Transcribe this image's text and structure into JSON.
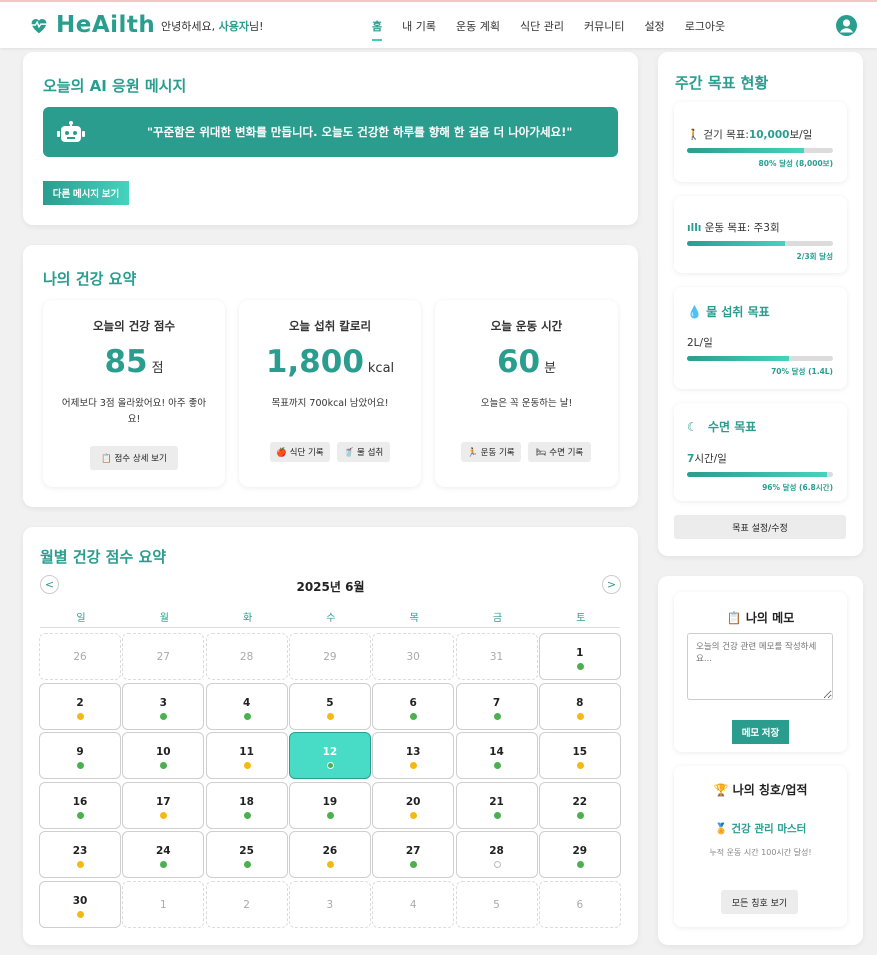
{
  "app": {
    "logo": "HeAilth",
    "greeting_prefix": "안녕하세요,",
    "user_name": "사용자",
    "greeting_suffix": "님!"
  },
  "nav": [
    "홈",
    "내 기록",
    "운동 계획",
    "식단 관리",
    "커뮤니티",
    "설정",
    "로그아웃"
  ],
  "nav_active": "홈",
  "ai": {
    "title": "오늘의 AI 응원 메시지",
    "message": "\"꾸준함은 위대한 변화를 만듭니다. 오늘도 건강한 하루를 향해 한 걸음 더 나아가세요!\"",
    "button": "다른 메시지 보기"
  },
  "summary": {
    "title": "나의 건강 요약",
    "score": {
      "title": "오늘의 건강 점수",
      "value": "85",
      "unit": "점",
      "desc": "어제보다 3점 올라왔어요! 아주 좋아요!",
      "button": "📋 점수 상세 보기"
    },
    "calories": {
      "title": "오늘 섭취 칼로리",
      "value": "1,800",
      "unit": "kcal",
      "desc": "목표까지 700kcal 남았어요!",
      "button1": "🍎 식단 기록",
      "button2": "🥤 물 섭취"
    },
    "exercise": {
      "title": "오늘 운동 시간",
      "value": "60",
      "unit": "분",
      "desc": "오늘은 꼭 운동하는 날!",
      "button1": "🏃 운동 기록",
      "button2": "🛏 수면 기록"
    }
  },
  "calendar": {
    "title": "월별 건강 점수 요약",
    "month": "2025년 6월",
    "prev": "<",
    "next": ">",
    "weekdays": [
      "일",
      "월",
      "화",
      "수",
      "목",
      "금",
      "토"
    ],
    "days": [
      {
        "n": "26",
        "t": "o"
      },
      {
        "n": "27",
        "t": "o"
      },
      {
        "n": "28",
        "t": "o"
      },
      {
        "n": "29",
        "t": "o"
      },
      {
        "n": "30",
        "t": "o"
      },
      {
        "n": "31",
        "t": "o"
      },
      {
        "n": "1",
        "t": "c",
        "d": "g"
      },
      {
        "n": "2",
        "t": "c",
        "d": "y"
      },
      {
        "n": "3",
        "t": "c",
        "d": "g"
      },
      {
        "n": "4",
        "t": "c",
        "d": "g"
      },
      {
        "n": "5",
        "t": "c",
        "d": "y"
      },
      {
        "n": "6",
        "t": "c",
        "d": "g"
      },
      {
        "n": "7",
        "t": "c",
        "d": "g"
      },
      {
        "n": "8",
        "t": "c",
        "d": "y"
      },
      {
        "n": "9",
        "t": "c",
        "d": "g"
      },
      {
        "n": "10",
        "t": "c",
        "d": "g"
      },
      {
        "n": "11",
        "t": "c",
        "d": "y"
      },
      {
        "n": "12",
        "t": "today",
        "d": "w"
      },
      {
        "n": "13",
        "t": "c",
        "d": "y"
      },
      {
        "n": "14",
        "t": "c",
        "d": "g"
      },
      {
        "n": "15",
        "t": "c",
        "d": "y"
      },
      {
        "n": "16",
        "t": "c",
        "d": "g"
      },
      {
        "n": "17",
        "t": "c",
        "d": "y"
      },
      {
        "n": "18",
        "t": "c",
        "d": "g"
      },
      {
        "n": "19",
        "t": "c",
        "d": "g"
      },
      {
        "n": "20",
        "t": "c",
        "d": "y"
      },
      {
        "n": "21",
        "t": "c",
        "d": "g"
      },
      {
        "n": "22",
        "t": "c",
        "d": "g"
      },
      {
        "n": "23",
        "t": "c",
        "d": "y"
      },
      {
        "n": "24",
        "t": "c",
        "d": "g"
      },
      {
        "n": "25",
        "t": "c",
        "d": "g"
      },
      {
        "n": "26",
        "t": "c",
        "d": "y"
      },
      {
        "n": "27",
        "t": "c",
        "d": "g"
      },
      {
        "n": "28",
        "t": "c",
        "d": "e"
      },
      {
        "n": "29",
        "t": "c",
        "d": "g"
      },
      {
        "n": "30",
        "t": "c",
        "d": "y"
      },
      {
        "n": "1",
        "t": "o"
      },
      {
        "n": "2",
        "t": "o"
      },
      {
        "n": "3",
        "t": "o"
      },
      {
        "n": "4",
        "t": "o"
      },
      {
        "n": "5",
        "t": "o"
      },
      {
        "n": "6",
        "t": "o"
      }
    ]
  },
  "goals": {
    "title": "주간 목표 현황",
    "walk": {
      "prefix": "걷기 목표:",
      "value": "10,000",
      "suffix": "보/일",
      "pct": "80% 달성 (8,000보)",
      "progress": 0.8
    },
    "exercise": {
      "label": "운동 목표: 주3회",
      "pct": "2/3회 달성",
      "progress": 0.67
    },
    "water": {
      "title": "물 섭취 목표",
      "label": "2L/일",
      "pct": "70% 달성 (1.4L)",
      "progress": 0.7
    },
    "sleep": {
      "title": "수면 목표",
      "prefix": "7",
      "suffix": "시간/일",
      "pct": "96% 달성 (6.8시간)",
      "progress": 0.96
    },
    "button": "목표 설정/수정"
  },
  "memo": {
    "title": "나의 메모",
    "placeholder": "오늘의 건강 관련 메모를 작성하세요...",
    "button": "메모 저장"
  },
  "achievement": {
    "title": "나의 칭호/업적",
    "badge": "🏅 건강 관리 마스터",
    "desc": "누적 운동 시간 100시간 달성!",
    "button": "모든 칭호 보기"
  },
  "colors": {
    "primary": "#2a9d8f",
    "accent": "#46d3be",
    "good": "#4caf50",
    "warn": "#f5b914"
  }
}
